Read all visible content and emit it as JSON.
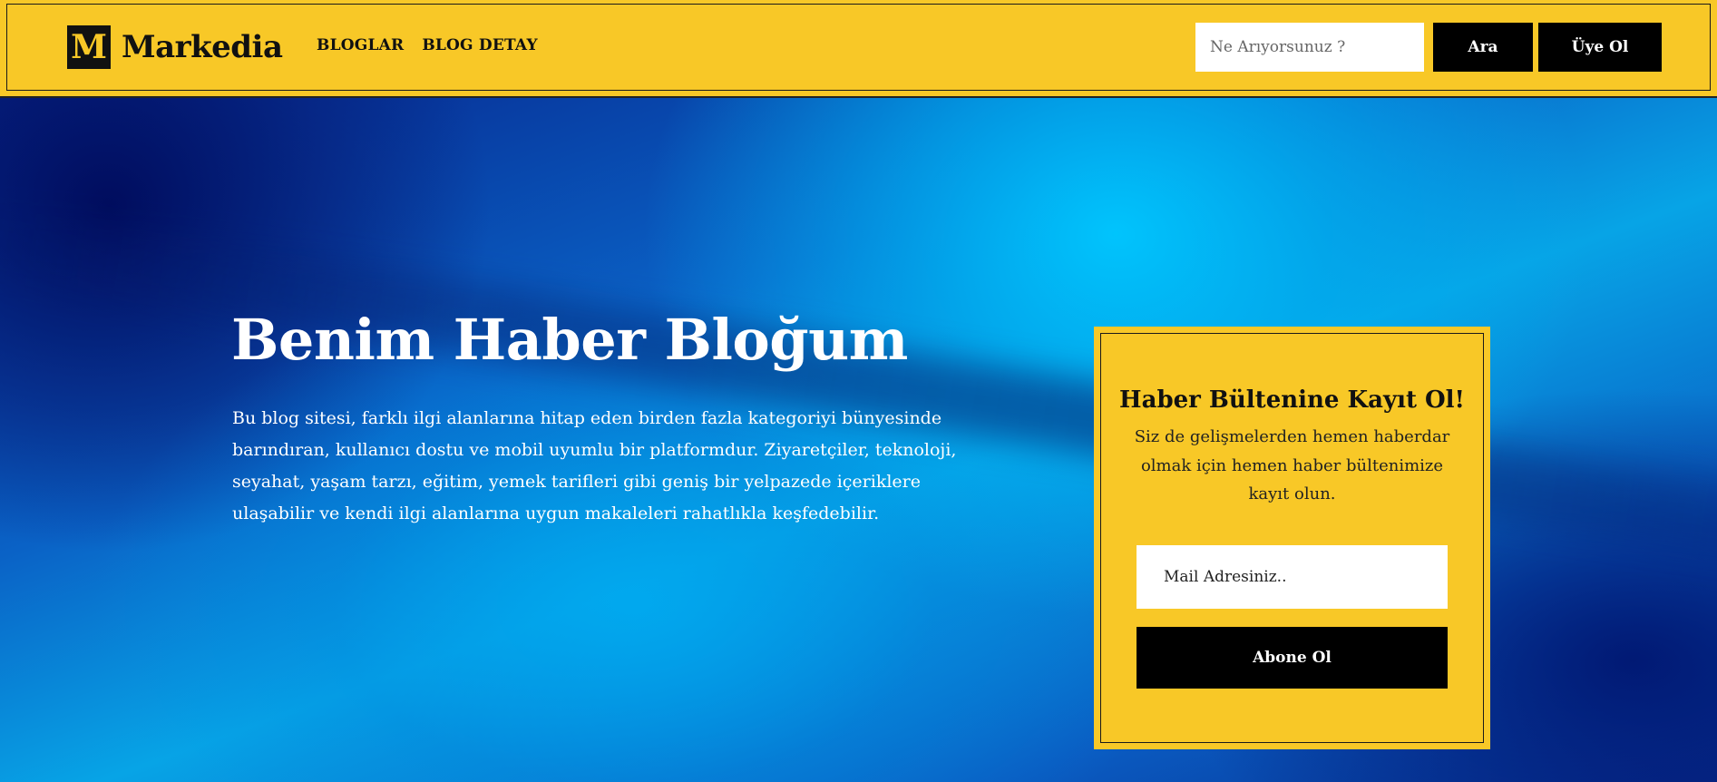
{
  "header": {
    "logo_letter": "M",
    "logo_text": "Markedia",
    "nav": [
      {
        "label": "BLOGLAR"
      },
      {
        "label": "BLOG DETAY"
      }
    ],
    "search_placeholder": "Ne Arıyorsunuz ?",
    "search_button": "Ara",
    "signup_button": "Üye Ol"
  },
  "hero": {
    "title": "Benim Haber Bloğum",
    "description": "Bu blog sitesi, farklı ilgi alanlarına hitap eden birden fazla kategoriyi bünyesinde barındıran, kullanıcı dostu ve mobil uyumlu bir platformdur. Ziyaretçiler, teknoloji, seyahat, yaşam tarzı, eğitim, yemek tarifleri gibi geniş bir yelpazede içeriklere ulaşabilir ve kendi ilgi alanlarına uygun makaleleri rahatlıkla keşfedebilir."
  },
  "newsletter": {
    "title": "Haber Bültenine Kayıt Ol!",
    "description": "Siz de gelişmelerden hemen haberdar olmak için hemen haber bültenimize kayıt olun.",
    "email_placeholder": "Mail Adresiniz..",
    "subscribe_button": "Abone Ol"
  },
  "colors": {
    "accent_yellow": "#f8c827",
    "button_black": "#000000",
    "hero_blue": "#0a62c6"
  }
}
